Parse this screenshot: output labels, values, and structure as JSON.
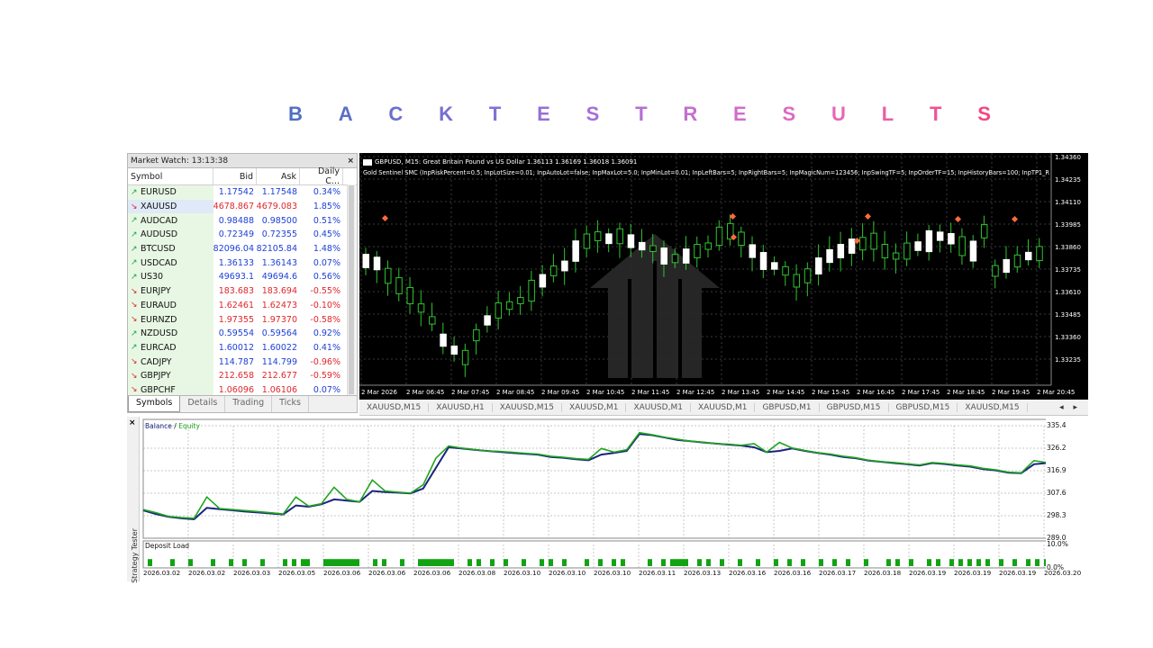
{
  "heading": {
    "letters": [
      "B",
      "A",
      "C",
      "K",
      "T",
      "E",
      "S",
      "T",
      "R",
      "E",
      "S",
      "U",
      "L",
      "T",
      "S"
    ],
    "colors": [
      "#4f6fc1",
      "#5a6fc7",
      "#6a6fcc",
      "#776fcf",
      "#866fd3",
      "#9670d5",
      "#a66fd6",
      "#b46fd4",
      "#c46fcf",
      "#d26ccb",
      "#dd6ac3",
      "#e567b6",
      "#ea5ea4",
      "#ef5392",
      "#f4467e"
    ]
  },
  "market_watch": {
    "title": "Market Watch: 13:13:38",
    "close": "×",
    "columns": [
      "Symbol",
      "Bid",
      "Ask",
      "Daily C..."
    ],
    "rows": [
      {
        "symbol": "EURUSD",
        "bid": "1.17542",
        "ask": "1.17548",
        "change": "0.34%",
        "dir": "up",
        "color": "blue"
      },
      {
        "symbol": "XAUUSD",
        "bid": "4678.867",
        "ask": "4679.083",
        "change": "1.85%",
        "dir": "down",
        "color": "red",
        "selected": true
      },
      {
        "symbol": "AUDCAD",
        "bid": "0.98488",
        "ask": "0.98500",
        "change": "0.51%",
        "dir": "up",
        "color": "blue"
      },
      {
        "symbol": "AUDUSD",
        "bid": "0.72349",
        "ask": "0.72355",
        "change": "0.45%",
        "dir": "up",
        "color": "blue"
      },
      {
        "symbol": "BTCUSD",
        "bid": "82096.04",
        "ask": "82105.84",
        "change": "1.48%",
        "dir": "up",
        "color": "blue"
      },
      {
        "symbol": "USDCAD",
        "bid": "1.36133",
        "ask": "1.36143",
        "change": "0.07%",
        "dir": "up",
        "color": "blue"
      },
      {
        "symbol": "US30",
        "bid": "49693.1",
        "ask": "49694.6",
        "change": "0.56%",
        "dir": "up",
        "color": "blue"
      },
      {
        "symbol": "EURJPY",
        "bid": "183.683",
        "ask": "183.694",
        "change": "-0.55%",
        "dir": "down",
        "color": "red"
      },
      {
        "symbol": "EURAUD",
        "bid": "1.62461",
        "ask": "1.62473",
        "change": "-0.10%",
        "dir": "down",
        "color": "red"
      },
      {
        "symbol": "EURNZD",
        "bid": "1.97355",
        "ask": "1.97370",
        "change": "-0.58%",
        "dir": "down",
        "color": "red"
      },
      {
        "symbol": "NZDUSD",
        "bid": "0.59554",
        "ask": "0.59564",
        "change": "0.92%",
        "dir": "up",
        "color": "blue"
      },
      {
        "symbol": "EURCAD",
        "bid": "1.60012",
        "ask": "1.60022",
        "change": "0.41%",
        "dir": "up",
        "color": "blue"
      },
      {
        "symbol": "CADJPY",
        "bid": "114.787",
        "ask": "114.799",
        "change": "-0.96%",
        "dir": "down",
        "color": "blue"
      },
      {
        "symbol": "GBPJPY",
        "bid": "212.658",
        "ask": "212.677",
        "change": "-0.59%",
        "dir": "down",
        "color": "red"
      },
      {
        "symbol": "GBPCHF",
        "bid": "1.06096",
        "ask": "1.06106",
        "change": "0.07%",
        "dir": "down",
        "color": "red"
      }
    ],
    "tabs": [
      "Symbols",
      "Details",
      "Trading",
      "Ticks"
    ],
    "active_tab": "Symbols",
    "colors": {
      "blue": "#1e40d6",
      "red": "#e0262b",
      "up_arrow": "#16a34a",
      "down_arrow": "#dc2626"
    }
  },
  "price_chart": {
    "info": "GBPUSD, M15:  Great Britain Pound vs US Dollar  1.36113  1.36169  1.36018  1.36091",
    "params": "Gold Sentinel SMC (InpRiskPercent=0.5; InpLotSize=0.01; InpAutoLot=false; InpMaxLot=5.0; InpMinLot=0.01; InpLeftBars=5; InpRightBars=5; InpMagicNum=123456; InpSwingTF=5; InpOrderTF=15; InpHistoryBars=100; InpTP1_R",
    "y_labels": [
      "1.34360",
      "1.34235",
      "1.34110",
      "1.33985",
      "1.33860",
      "1.33735",
      "1.33610",
      "1.33485",
      "1.33360",
      "1.33235"
    ],
    "x_labels": [
      "2 Mar 2026",
      "2 Mar 06:45",
      "2 Mar 07:45",
      "2 Mar 08:45",
      "2 Mar 09:45",
      "2 Mar 10:45",
      "2 Mar 11:45",
      "2 Mar 12:45",
      "2 Mar 13:45",
      "2 Mar 14:45",
      "2 Mar 15:45",
      "2 Mar 16:45",
      "2 Mar 17:45",
      "2 Mar 18:45",
      "2 Mar 19:45",
      "2 Mar 20:45"
    ],
    "tabs": [
      "XAUUSD,M15",
      "XAUUSD,H1",
      "XAUUSD,M15",
      "XAUUSD,M1",
      "XAUUSD,M1",
      "XAUUSD,M1",
      "GBPUSD,M1",
      "GBPUSD,M15",
      "GBPUSD,M15",
      "XAUUSD,M15"
    ],
    "tab_arrows": "◂ ▸",
    "colors": {
      "bg": "#000000",
      "bull": "#ffffff",
      "wick": "#2fc42f",
      "grid": "#3a3a3a"
    }
  },
  "tester": {
    "side_label": "Strategy Tester",
    "close": "×",
    "legend_balance": "Balance",
    "legend_sep": " / ",
    "legend_equity": "Equity",
    "deposit_label": "Deposit Load",
    "y_labels": [
      "335.4",
      "326.2",
      "316.9",
      "307.6",
      "298.3",
      "289.0"
    ],
    "dep_labels": [
      "10.0%",
      "0.0%"
    ],
    "x_labels": [
      "2026.03.02",
      "2026.03.02",
      "2026.03.03",
      "2026.03.05",
      "2026.03.06",
      "2026.03.06",
      "2026.03.06",
      "2026.03.08",
      "2026.03.10",
      "2026.03.10",
      "2026.03.10",
      "2026.03.11",
      "2026.03.13",
      "2026.03.16",
      "2026.03.16",
      "2026.03.17",
      "2026.03.18",
      "2026.03.19",
      "2026.03.19",
      "2026.03.19",
      "2026.03.20"
    ],
    "colors": {
      "balance": "#1a237e",
      "equity": "#1fa51f",
      "deposit": "#12a312",
      "grid": "#c8c8c8"
    }
  },
  "chart_data": [
    {
      "type": "line",
      "title": "",
      "series": [
        {
          "name": "Balance",
          "values": [
            300.5,
            299.0,
            297.8,
            297.2,
            296.8,
            301.5,
            301.0,
            300.5,
            300.0,
            299.6,
            299.2,
            298.8,
            302.5,
            302.0,
            303.0,
            305.0,
            304.5,
            304.0,
            308.5,
            308.0,
            307.8,
            307.5,
            309.5,
            318.0,
            326.5,
            326.0,
            325.5,
            325.0,
            324.6,
            324.2,
            323.8,
            323.5,
            322.5,
            322.2,
            321.6,
            321.2,
            323.5,
            324.2,
            325.0,
            332.0,
            331.5,
            330.5,
            329.5,
            329.0,
            328.5,
            328.0,
            327.6,
            327.2,
            326.5,
            324.5,
            325.0,
            326.0,
            325.0,
            324.2,
            323.5,
            322.5,
            322.0,
            321.0,
            320.5,
            320.0,
            319.5,
            319.0,
            320.0,
            319.6,
            319.0,
            318.5,
            317.5,
            317.0,
            316.0,
            315.8,
            319.5,
            320.0
          ]
        },
        {
          "name": "Equity",
          "values": [
            300.8,
            299.5,
            298.0,
            297.5,
            297.2,
            306.0,
            301.2,
            300.8,
            300.4,
            300.0,
            299.5,
            299.0,
            306.0,
            302.2,
            303.2,
            310.0,
            305.0,
            304.0,
            313.0,
            308.5,
            308.0,
            307.6,
            311.0,
            322.0,
            327.0,
            326.2,
            325.6,
            325.0,
            324.8,
            324.4,
            324.0,
            323.7,
            322.8,
            322.4,
            321.8,
            321.5,
            326.0,
            324.5,
            325.5,
            332.5,
            331.7,
            330.6,
            329.8,
            329.0,
            328.6,
            328.0,
            327.8,
            327.3,
            328.0,
            324.5,
            328.5,
            326.2,
            325.2,
            324.3,
            323.7,
            322.8,
            322.2,
            321.2,
            320.6,
            320.2,
            319.7,
            319.2,
            320.2,
            319.8,
            319.2,
            318.8,
            317.8,
            317.2,
            316.2,
            316.0,
            321.0,
            320.2
          ]
        }
      ],
      "ylim": [
        289.0,
        335.4
      ],
      "xlabel": "",
      "ylabel": "",
      "grid": true,
      "legend": "top-left"
    },
    {
      "type": "bar",
      "title": "Deposit Load",
      "values": [
        1,
        1,
        1,
        1,
        1,
        1,
        1,
        1,
        1,
        1,
        1,
        1,
        1,
        1,
        1,
        1,
        1,
        1,
        1,
        1,
        1,
        1,
        1,
        1,
        1,
        1,
        1,
        1,
        1,
        1,
        1,
        1,
        1,
        1,
        1,
        1,
        1,
        1,
        1,
        1,
        1,
        1,
        1,
        1,
        1,
        1,
        1,
        1,
        1,
        1,
        1,
        1,
        1,
        1,
        1,
        1,
        1,
        1,
        1,
        1,
        1,
        1,
        1,
        1,
        1,
        1,
        1,
        1,
        1,
        1,
        1,
        1,
        1,
        1,
        1,
        1,
        1,
        1,
        1,
        1,
        1,
        1,
        1,
        1,
        1,
        1,
        1,
        1,
        1,
        1
      ],
      "unit": "%",
      "ylim": [
        0.0,
        10.0
      ]
    }
  ]
}
